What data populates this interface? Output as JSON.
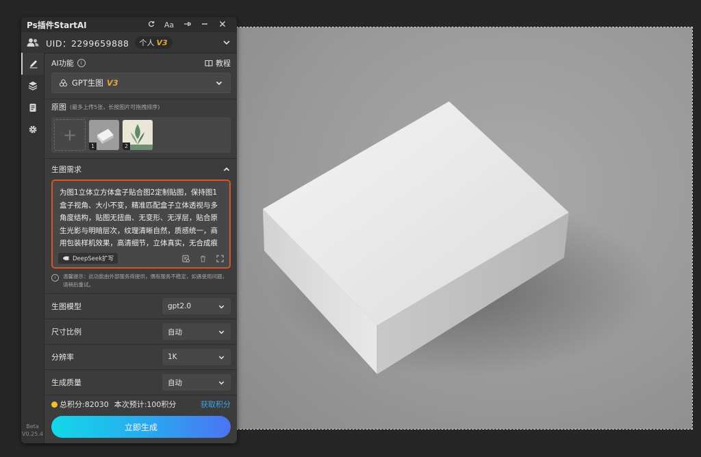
{
  "panel": {
    "title": "Ps插件StartAI",
    "uid_text": "UID：2299659888",
    "account_badge": "个人",
    "account_level": "V3"
  },
  "sidebar": {
    "items": [
      "pen-icon",
      "layers-icon",
      "clipboard-icon",
      "gear-icon"
    ],
    "version_label": "Beta",
    "version": "V0.25.4"
  },
  "ai_function": {
    "label": "AI功能",
    "tutorial_label": "教程",
    "selected": "GPT生图",
    "selected_level": "V3"
  },
  "source_images": {
    "label": "原图",
    "hint": "(最多上传5张，长按图片可拖拽排序)",
    "thumbs": [
      "1",
      "2"
    ]
  },
  "prompt": {
    "section_label": "生图需求",
    "text": "为图1立体立方体盒子贴合图2定制贴图，保持图1盒子视角、大小不变，精准匹配盒子立体透视与多角度结构，贴图无扭曲、无变形、无浮层，贴合原生光影与明暗层次，纹理清晰自然，质感统一，商用包装样机效果，高清细节，立体真实，无合成痕迹",
    "deepseek_label": "DeepSeek扩写"
  },
  "notice": "温馨提示：此功能由外部服务商提供，偶有服务不稳定，如遇使用问题，请稍后重试。",
  "options": [
    {
      "label": "生图模型",
      "value": "gpt2.0"
    },
    {
      "label": "尺寸比例",
      "value": "自动"
    },
    {
      "label": "分辨率",
      "value": "1K"
    },
    {
      "label": "生成质量",
      "value": "自动"
    }
  ],
  "points": {
    "total": "总积分:82030",
    "estimate": "本次预计:100积分",
    "get_label": "获取积分"
  },
  "generate_label": "立即生成",
  "colors": {
    "accent_border": "#d9532c",
    "level_gold": "#e7a43c",
    "link_blue": "#3ea3e8",
    "button_gradient_start": "#12d9e9",
    "button_gradient_end": "#4b74f2"
  }
}
